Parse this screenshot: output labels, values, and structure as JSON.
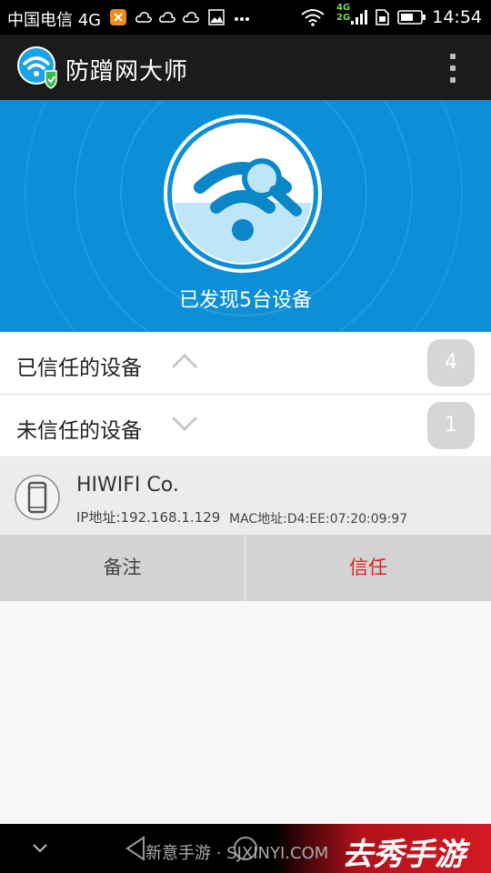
{
  "status_bar": {
    "carrier": "中国电信 4G",
    "network_labels": [
      "4G",
      "2G"
    ],
    "time": "14:54"
  },
  "app_bar": {
    "title": "防蹭网大师",
    "logo_icon": "wifi-shield-icon",
    "menu_icon": "more-vertical-icon"
  },
  "hero": {
    "icon": "wifi-search-icon",
    "discovered_text": "已发现5台设备"
  },
  "groups": [
    {
      "label": "已信任的设备",
      "count": "4",
      "expanded": true
    },
    {
      "label": "未信任的设备",
      "count": "1",
      "expanded": false
    }
  ],
  "device": {
    "icon": "smartphone-icon",
    "name": "HIWIFI Co.",
    "ip_text": "IP地址:192.168.1.129",
    "mac_text": "MAC地址:D4:EE:07:20:09:97"
  },
  "actions": {
    "note_label": "备注",
    "trust_label": "信任"
  },
  "watermark": {
    "left_text": "新意手游 · SJXINYI.COM",
    "right_text": "去秀手游"
  },
  "colors": {
    "hero_bg": "#0c8fd6",
    "trust_text": "#e02020",
    "badge_bg": "#d6d6d6"
  }
}
